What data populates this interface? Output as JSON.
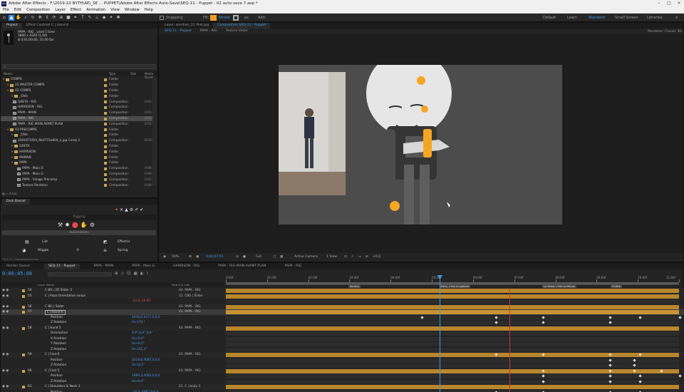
{
  "title_bar": {
    "app_icon": "Ae",
    "title": "Adobe After Effects - F:\\2019-10 NYTH\\AE\\_SE ... PUPPET\\Adobe After Effects Auto-Save\\SEQ-11 - Puppet - 02 auto-save 7.aep *"
  },
  "menu": [
    "File",
    "Edit",
    "Composition",
    "Layer",
    "Effect",
    "Animation",
    "View",
    "Window",
    "Help"
  ],
  "toolbar": {
    "snapping_label": "Snapping",
    "fill_label": "Fill:",
    "stroke_label": "Stroke",
    "stroke_px": "px",
    "add_label": "Add:",
    "workspaces": [
      "Default",
      "Learn",
      "Standard",
      "Small Screen",
      "Libraries"
    ],
    "active_workspace": "Standard",
    "search_placeholder": "Search Help"
  },
  "project_panel": {
    "tab_project": "Project",
    "tab_effect_controls": "Effect Controls C | Hand 6",
    "selected_item": {
      "name": "PAPA - RIG",
      "usage": ", used 1 time",
      "dims": "3840 x 4320 (1,00)",
      "duration": "Δ 0;01;00;00, 25,00 fps"
    },
    "columns": [
      "Name",
      "Type",
      "Size",
      "Media Durat"
    ],
    "items": [
      {
        "name": "COMPS",
        "type": "Folder",
        "size": "",
        "color": "#c9a54b",
        "icon": "folder",
        "indent": 0,
        "sel": false
      },
      {
        "name": "01 MASTER COMPS",
        "type": "Folder",
        "size": "",
        "color": "#c9a54b",
        "icon": "folder",
        "indent": 1,
        "sel": false
      },
      {
        "name": "02 COMPS",
        "type": "Folder",
        "size": "",
        "color": "#c9a54b",
        "icon": "folder",
        "indent": 1,
        "sel": false
      },
      {
        "name": "_Olds",
        "type": "Folder",
        "size": "",
        "color": "#c9a54b",
        "icon": "folder",
        "indent": 2,
        "sel": false
      },
      {
        "name": "GRETA - RIG",
        "type": "Composition",
        "size": "0:01:0",
        "color": "#c9a54b",
        "icon": "comp",
        "indent": 2,
        "sel": false
      },
      {
        "name": "HARRISON - RIG",
        "type": "Composition",
        "size": "",
        "color": "#c9a54b",
        "icon": "comp",
        "indent": 2,
        "sel": false
      },
      {
        "name": "PAPA - MAIN",
        "type": "Composition",
        "size": "0:01:0",
        "color": "#c9a54b",
        "icon": "comp",
        "indent": 2,
        "sel": false
      },
      {
        "name": "PAPA - RIG",
        "type": "Composition",
        "size": "0:01:0",
        "color": "#c9a54b",
        "icon": "comp",
        "indent": 2,
        "sel": true
      },
      {
        "name": "PAPA - RIG MAIN AVANT PLAN",
        "type": "Composition",
        "size": "0:01:0",
        "color": "#c9a54b",
        "icon": "comp",
        "indent": 2,
        "sel": false
      },
      {
        "name": "03 PRECOMPS",
        "type": "Folder",
        "size": "",
        "color": "#c9a54b",
        "icon": "folder",
        "indent": 1,
        "sel": false
      },
      {
        "name": "_Olds",
        "type": "Folder",
        "size": "",
        "color": "#c9a54b",
        "icon": "folder",
        "indent": 2,
        "sel": false
      },
      {
        "name": "26919T1954_6b0772e804_o.jpg Comp 1",
        "type": "Composition",
        "size": "0:03:",
        "color": "#c9a54b",
        "icon": "comp",
        "indent": 2,
        "sel": false
      },
      {
        "name": "GRETA",
        "type": "Folder",
        "size": "",
        "color": "#c9a54b",
        "icon": "folder",
        "indent": 2,
        "sel": false
      },
      {
        "name": "HARRISON",
        "type": "Folder",
        "size": "",
        "color": "#c9a54b",
        "icon": "folder",
        "indent": 2,
        "sel": false
      },
      {
        "name": "MAMAN",
        "type": "Folder",
        "size": "",
        "color": "#c9a54b",
        "icon": "folder",
        "indent": 2,
        "sel": false
      },
      {
        "name": "PAPA",
        "type": "Folder",
        "size": "",
        "color": "#c9a54b",
        "icon": "folder",
        "indent": 2,
        "sel": false
      },
      {
        "name": "PAPA - Main D",
        "type": "Composition",
        "size": "0:00:",
        "color": "#c9a54b",
        "icon": "comp",
        "indent": 3,
        "sel": false
      },
      {
        "name": "PAPA - Main G",
        "type": "Composition",
        "size": "0:00:",
        "color": "#c9a54b",
        "icon": "comp",
        "indent": 3,
        "sel": false
      },
      {
        "name": "PAPA - Visage Precomp",
        "type": "Composition",
        "size": "0:01:",
        "color": "#c9a54b",
        "icon": "comp",
        "indent": 3,
        "sel": false
      },
      {
        "name": "Texture Pantalon",
        "type": "Composition",
        "size": "0:00:",
        "color": "#c9a54b",
        "icon": "comp",
        "indent": 3,
        "sel": false
      }
    ],
    "footer": "8 bpc"
  },
  "duik_panel": {
    "tab": "Duik Bassel",
    "rigging_label": "Rigging",
    "automations_label": "Automations",
    "list_label": "List",
    "effector_label": "Effector",
    "wiggle_label": "Wiggle",
    "spring_label": "Spring",
    "status": "16.0.12 | rainboxprod.coop"
  },
  "viewer": {
    "layer_tab": "Layer: annitrec_21 Pink.jpg",
    "comp_tab": "Composition SEQ-11 - Puppet",
    "subtabs": [
      "SEQ-11 - Puppet",
      "PAPA - RIG",
      "Texture Veste"
    ],
    "renderer_label": "Renderer:",
    "renderer_value": "Classic 3D",
    "zoom": "50%",
    "timecode": "0;00;07;01",
    "resolution": "Full",
    "camera": "Active Camera",
    "views": "1 View",
    "exposure": "+0,0"
  },
  "timeline": {
    "tabs": [
      "Render Queue",
      "SEQ-11 - Puppet",
      "PAPA - MAIN",
      "PAPA - Main G",
      "HARRISON - RIG",
      "PAPA - RIG MAIN AVANT PLAN",
      "PAPA - RIG"
    ],
    "active_tab": "SEQ-11 - Puppet",
    "current_time": "0:00:05:08",
    "search_placeholder": "",
    "columns": [
      "Layer Name",
      "Parent & Link"
    ],
    "ruler": [
      "0:00f",
      "01:00f",
      "02:00f",
      "03:00f",
      "04:00f",
      "05:00f",
      "06:00f",
      "07:00f",
      "08:00f",
      "09:00f",
      "10:00f",
      "11:00f"
    ],
    "markers": [
      "Sourire",
      "Paris, c'est la capitale",
      "La Seine, c'est un fleuve",
      "Chiffre"
    ],
    "rows": [
      {
        "num": "54",
        "name": "C B0 | 2D Slider 3",
        "val": "",
        "parent": "43. PAPA - RIG",
        "bar": true,
        "sel": false
      },
      {
        "num": "55",
        "name": "C | Papa Orientation sonps",
        "val": "",
        "parent": "11. CBG | Slider",
        "bar": true,
        "sel": false
      },
      {
        "num": "",
        "name": "",
        "val": "-23.8,-26.65",
        "parent": "",
        "bar": false,
        "sel": false,
        "red": true
      },
      {
        "num": "56",
        "name": "C BG | Slider",
        "val": "",
        "parent": "43. PAPA - RIG",
        "bar": true,
        "sel": false
      },
      {
        "num": "57",
        "name": "C | Hand 6",
        "val": "",
        "parent": "43. PAPA - RIG",
        "bar": true,
        "sel": true
      },
      {
        "num": "",
        "name": "Position",
        "val": "2034,6,1677,0,0,0",
        "parent": "",
        "bar": false,
        "sel": false
      },
      {
        "num": "",
        "name": "Z Rotation",
        "val": "0x-170,*",
        "parent": "",
        "bar": false,
        "sel": false
      },
      {
        "num": "58",
        "name": "C | Hand 5",
        "val": "",
        "parent": "43. PAPA - RIG",
        "bar": true,
        "sel": false
      },
      {
        "num": "",
        "name": "Orientation",
        "val": "0,0°,0,0°,0,0°",
        "parent": "",
        "bar": false,
        "sel": false
      },
      {
        "num": "",
        "name": "X Rotation",
        "val": "0x+0,0°",
        "parent": "",
        "bar": false,
        "sel": false
      },
      {
        "num": "",
        "name": "Y Rotation",
        "val": "0x+0,0°",
        "parent": "",
        "bar": false,
        "sel": false
      },
      {
        "num": "",
        "name": "Z Rotation",
        "val": "0x-142,3°",
        "parent": "",
        "bar": false,
        "sel": false
      },
      {
        "num": "59",
        "name": "C | Foot 6",
        "val": "",
        "parent": "43. PAPA - RIG",
        "bar": true,
        "sel": false
      },
      {
        "num": "",
        "name": "Position",
        "val": "2218,8,4085,0,0,0",
        "parent": "",
        "bar": false,
        "sel": false
      },
      {
        "num": "",
        "name": "Z Rotation",
        "val": "0x-14,5°",
        "parent": "",
        "bar": false,
        "sel": false
      },
      {
        "num": "60",
        "name": "C | Foot 5",
        "val": "",
        "parent": "43. PAPA - RIG",
        "bar": true,
        "sel": false
      },
      {
        "num": "",
        "name": "Position",
        "val": "1960,3,4083,0,0,0",
        "parent": "",
        "bar": false,
        "sel": false
      },
      {
        "num": "",
        "name": "Z Rotation",
        "val": "0x+0,0°",
        "parent": "",
        "bar": false,
        "sel": false
      },
      {
        "num": "61",
        "name": "C | Shoulders & Neck 3",
        "val": "",
        "parent": "21. C | body 3",
        "bar": true,
        "sel": false
      },
      {
        "num": "",
        "name": "Position",
        "val": "-24,0,-4062,0,0,0",
        "parent": "",
        "bar": false,
        "sel": false
      },
      {
        "num": "",
        "name": "Z Rotation",
        "val": "0x-15,0°",
        "parent": "",
        "bar": false,
        "sel": false
      }
    ]
  },
  "colors": {
    "accent": "#2d8ceb",
    "playhead": "#3d9be9",
    "layer_bar": "#b8862c",
    "keyframe": "#dddddd",
    "red_line": "#d0312d"
  }
}
